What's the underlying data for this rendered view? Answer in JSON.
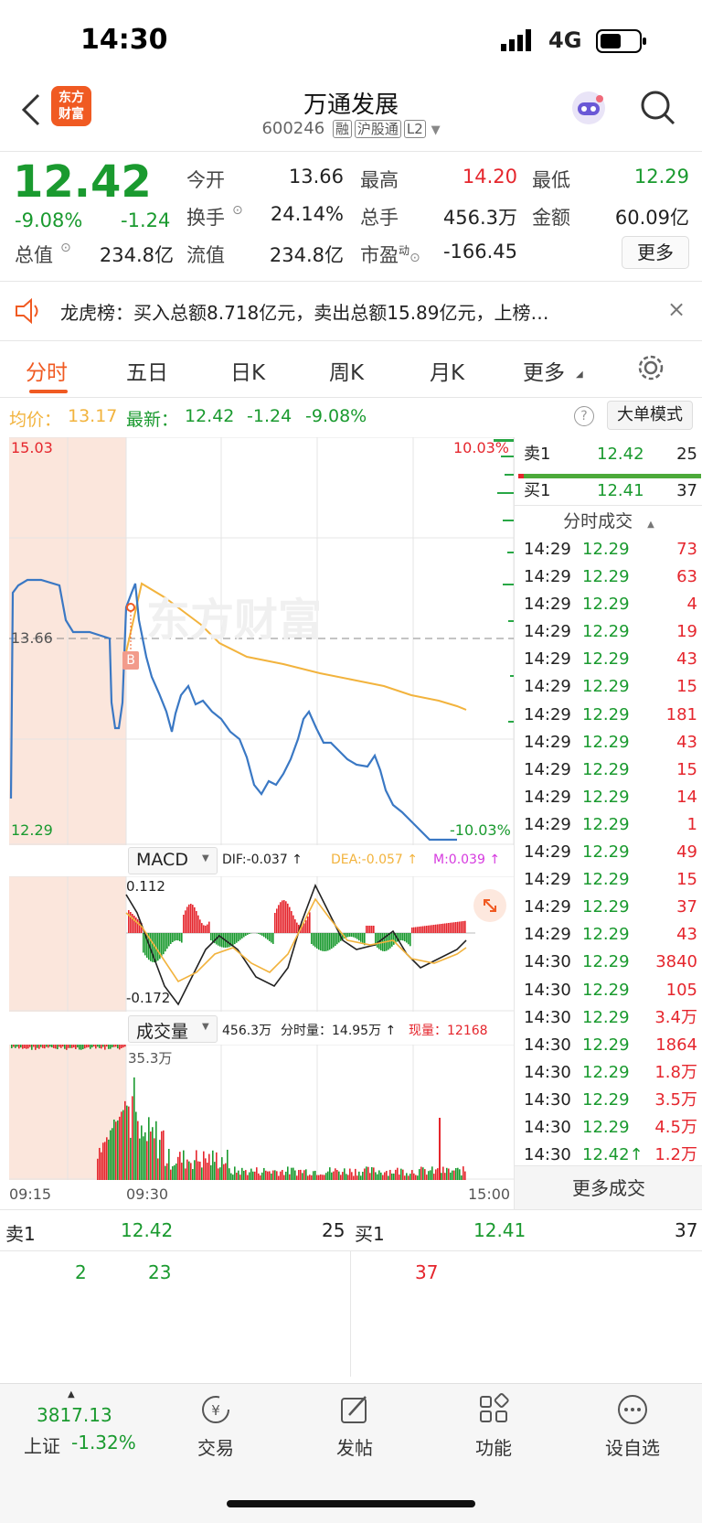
{
  "status": {
    "time": "14:30",
    "network": "4G"
  },
  "nav": {
    "brand_logo_text": "东方财富",
    "title": "万通发展",
    "code": "600246",
    "tags": [
      "融",
      "沪股通",
      "L2"
    ]
  },
  "quote": {
    "price": "12.42",
    "change_pct": "-9.08%",
    "change": "-1.24",
    "open_label": "今开",
    "open": "13.66",
    "high_label": "最高",
    "high": "14.20",
    "low_label": "最低",
    "low": "12.29",
    "turnover_label": "换手",
    "turnover": "24.14%",
    "volume_label": "总手",
    "volume": "456.3万",
    "amount_label": "金额",
    "amount": "60.09亿",
    "mcap_label": "总值",
    "mcap": "234.8亿",
    "float_label": "流值",
    "float": "234.8亿",
    "pe_label": "市盈",
    "pe_sup": "动",
    "pe": "-166.45",
    "more_button": "更多"
  },
  "notice": {
    "text": "龙虎榜：买入总额8.718亿元，卖出总额15.89亿元，上榜…"
  },
  "tabs": [
    "分时",
    "五日",
    "日K",
    "周K",
    "月K",
    "更多"
  ],
  "avgbar": {
    "avg_label": "均价：",
    "avg_value": "13.17",
    "latest_label": "最新：",
    "latest_value": "12.42",
    "latest_change": "-1.24",
    "latest_pct": "-9.08%",
    "bigorder_button": "大单模式"
  },
  "price_chart": {
    "top_price": "15.03",
    "bottom_price": "12.29",
    "ref_price": "13.66",
    "top_pct": "10.03%",
    "bottom_pct": "-10.03%",
    "watermark": "东方财富",
    "buy_marker": "B"
  },
  "macd": {
    "label": "MACD",
    "dif": "DIF:-0.037 ↑",
    "dea": "DEA:-0.057 ↑",
    "m": "M:0.039 ↑",
    "top": "0.112",
    "bottom": "-0.172"
  },
  "volume_panel": {
    "label": "成交量",
    "total": "456.3万",
    "min_vol": "分时量：14.95万 ↑",
    "cur_vol": "现量：12168",
    "max": "35.3万"
  },
  "time_axis": {
    "start": "09:15",
    "mid": "09:30",
    "end": "15:00"
  },
  "order_book_side": {
    "sell_label": "卖1",
    "sell_price": "12.42",
    "sell_vol": "25",
    "buy_label": "买1",
    "buy_price": "12.41",
    "buy_vol": "37",
    "ticks_header": "分时成交",
    "more_ticks": "更多成交"
  },
  "ticks": [
    {
      "t": "14:29",
      "p": "12.29",
      "v": "73"
    },
    {
      "t": "14:29",
      "p": "12.29",
      "v": "63"
    },
    {
      "t": "14:29",
      "p": "12.29",
      "v": "4"
    },
    {
      "t": "14:29",
      "p": "12.29",
      "v": "19"
    },
    {
      "t": "14:29",
      "p": "12.29",
      "v": "43"
    },
    {
      "t": "14:29",
      "p": "12.29",
      "v": "15"
    },
    {
      "t": "14:29",
      "p": "12.29",
      "v": "181"
    },
    {
      "t": "14:29",
      "p": "12.29",
      "v": "43"
    },
    {
      "t": "14:29",
      "p": "12.29",
      "v": "15"
    },
    {
      "t": "14:29",
      "p": "12.29",
      "v": "14"
    },
    {
      "t": "14:29",
      "p": "12.29",
      "v": "1"
    },
    {
      "t": "14:29",
      "p": "12.29",
      "v": "49"
    },
    {
      "t": "14:29",
      "p": "12.29",
      "v": "15"
    },
    {
      "t": "14:29",
      "p": "12.29",
      "v": "37"
    },
    {
      "t": "14:29",
      "p": "12.29",
      "v": "43"
    },
    {
      "t": "14:30",
      "p": "12.29",
      "v": "3840"
    },
    {
      "t": "14:30",
      "p": "12.29",
      "v": "105"
    },
    {
      "t": "14:30",
      "p": "12.29",
      "v": "3.4万"
    },
    {
      "t": "14:30",
      "p": "12.29",
      "v": "1864"
    },
    {
      "t": "14:30",
      "p": "12.29",
      "v": "1.8万"
    },
    {
      "t": "14:30",
      "p": "12.29",
      "v": "3.5万"
    },
    {
      "t": "14:30",
      "p": "12.29",
      "v": "4.5万"
    },
    {
      "t": "14:30",
      "p": "12.42↑",
      "v": "1.2万"
    }
  ],
  "bottom_book": {
    "sell_label": "卖1",
    "sell_price": "12.42",
    "sell_vol": "25",
    "buy_label": "买1",
    "buy_price": "12.41",
    "buy_vol": "37",
    "sell_detail": [
      "2",
      "23"
    ],
    "buy_detail": [
      "37"
    ]
  },
  "bottom_nav": {
    "index_value": "3817.13",
    "index_name": "上证",
    "index_pct": "-1.32%",
    "items": [
      "交易",
      "发帖",
      "功能",
      "设自选"
    ]
  },
  "colors": {
    "up": "#e5262d",
    "down": "#1a9a2f",
    "price_line": "#3a78c4",
    "avg_line": "#f2b33d",
    "brand": "#f05a22"
  }
}
